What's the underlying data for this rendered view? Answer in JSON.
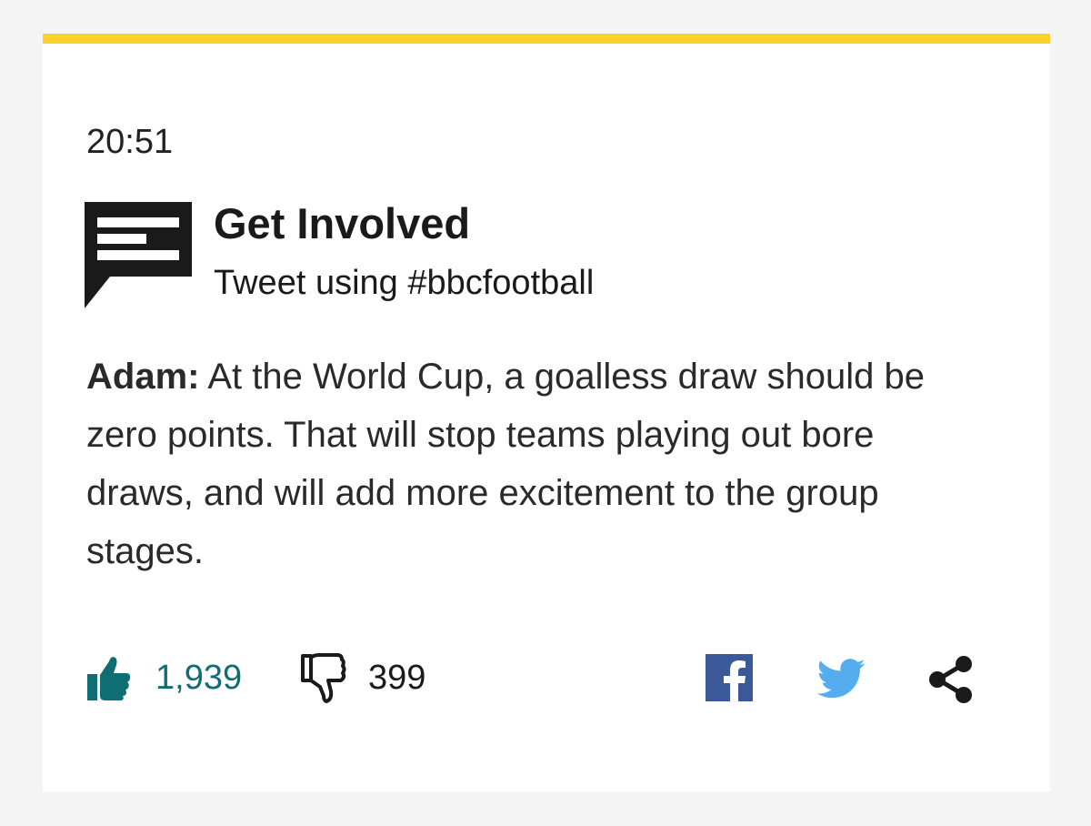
{
  "post": {
    "time": "20:51",
    "header": {
      "title": "Get Involved",
      "subtitle": "Tweet using #bbcfootball",
      "icon": "speech-bubble-icon"
    },
    "comment": {
      "author": "Adam:",
      "text": " At the World Cup, a goalless draw should be zero points. That will stop teams playing out bore draws, and will add more excitement to the group stages."
    },
    "reactions": {
      "likes": "1,939",
      "dislikes": "399"
    },
    "share": {
      "icons": [
        "facebook-icon",
        "twitter-icon",
        "share-icon"
      ]
    }
  },
  "colors": {
    "accent_bar": "#fdd22f",
    "like": "#0f6e74",
    "facebook": "#3b5998",
    "twitter": "#55acee"
  }
}
